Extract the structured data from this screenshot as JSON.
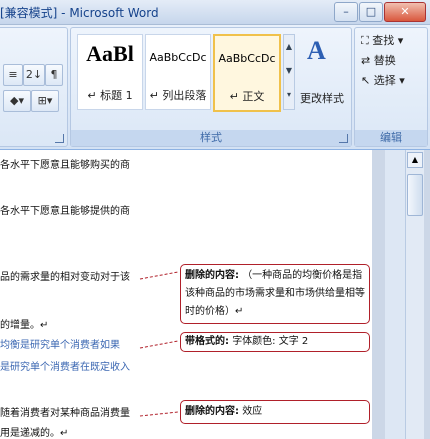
{
  "window": {
    "title": "[兼容模式] - Microsoft Word",
    "controls": {
      "minimize": "–",
      "maximize": "□",
      "close": "✕"
    }
  },
  "ribbon": {
    "paragraph_group": {
      "buttons": [
        "≡",
        "2↓",
        "¶"
      ]
    },
    "styles_group": {
      "label": "样式",
      "tiles": [
        {
          "sample": "AaBl",
          "name": "↵ 标题 1"
        },
        {
          "sample": "AaBbCcDc",
          "name": "↵ 列出段落"
        },
        {
          "sample": "AaBbCcDc",
          "name": "↵ 正文"
        }
      ],
      "change_styles_label": "更改样式"
    },
    "editing_group": {
      "label": "编辑",
      "items": [
        "查找",
        "替换",
        "选择"
      ]
    }
  },
  "document": {
    "lines": [
      "各水平下愿意且能够购买的商",
      "各水平下愿意且能够提供的商",
      "品的需求量的相对变动对于该",
      "的增量。↵",
      "均衡是研究单个消费者如果",
      "是研究单个消费者在既定收入",
      "随着消费者对某种商品消费量",
      "用是递减的。↵"
    ],
    "comments": [
      {
        "label": "删除的内容:",
        "text": "（一种商品的均衡价格是指该种商品的市场需求量和市场供给量相等时的价格）↵"
      },
      {
        "label": "带格式的:",
        "text": "字体颜色: 文字 2"
      },
      {
        "label": "删除的内容:",
        "text": "效应"
      }
    ]
  }
}
